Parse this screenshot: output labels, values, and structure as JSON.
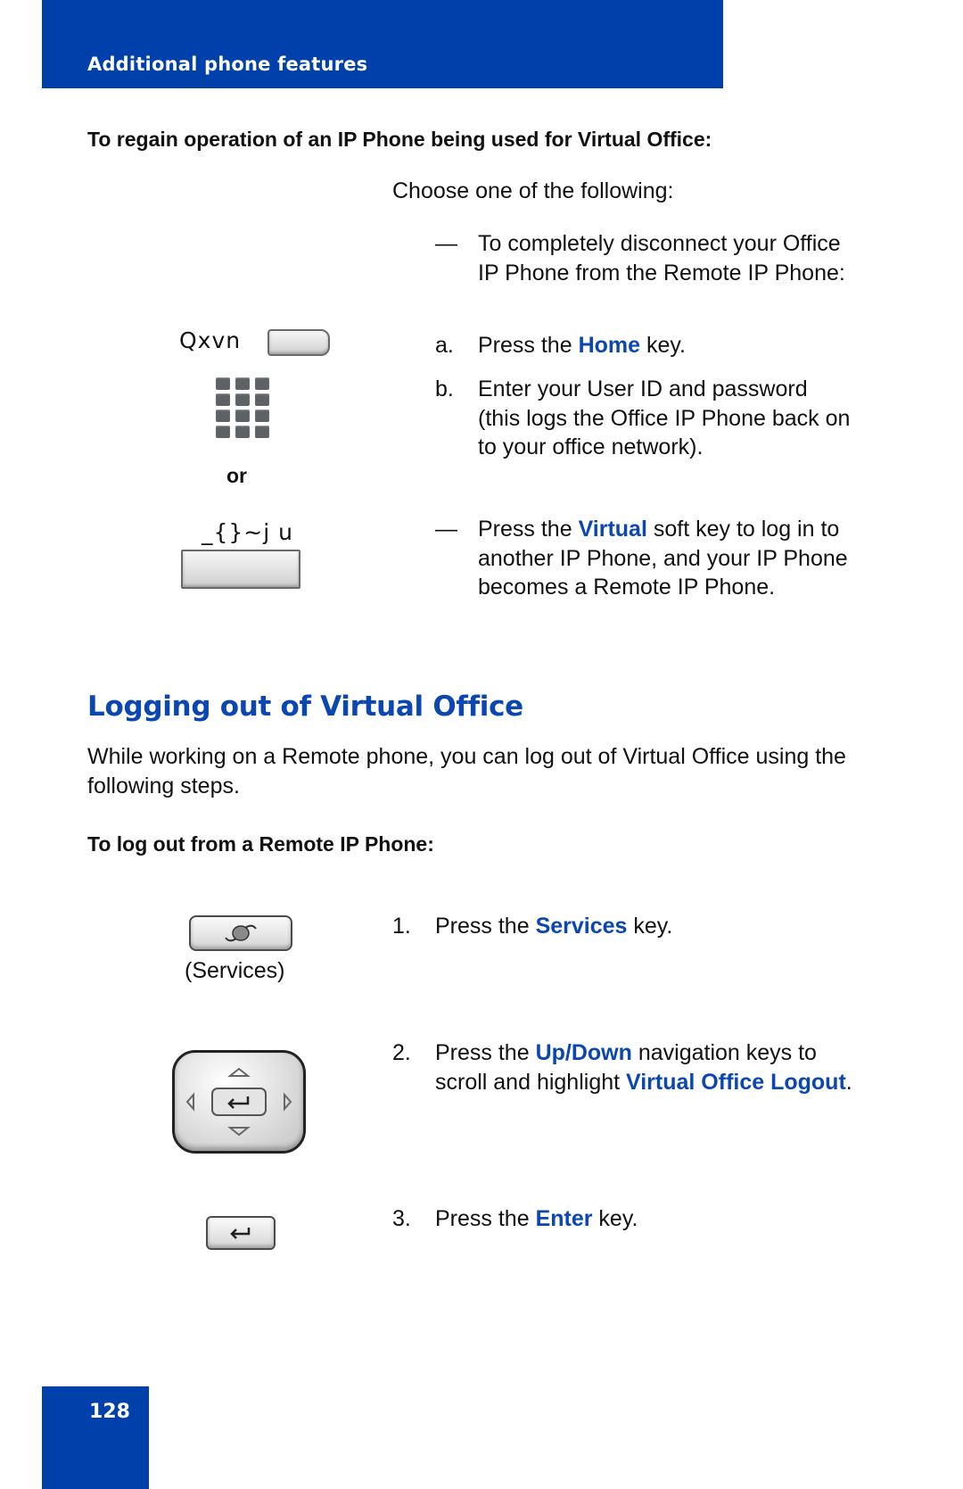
{
  "header": {
    "section_title": "Additional phone features"
  },
  "regain": {
    "title": "To regain operation of an IP Phone being used for Virtual Office:",
    "intro": "Choose one of the following:",
    "option1": {
      "marker": "—",
      "text": "To completely disconnect your Office IP Phone from the Remote IP Phone:",
      "steps": [
        {
          "marker": "a.",
          "pre": "Press the ",
          "key": "Home",
          "post": " key."
        },
        {
          "marker": "b.",
          "text": "Enter your User ID and password (this logs the Office IP Phone back on to your office network)."
        }
      ]
    },
    "option2": {
      "marker": "—",
      "pre": "Press the ",
      "key": "Virtual",
      "post": " soft key to log in to another IP Phone, and your IP Phone becomes a Remote IP Phone."
    },
    "left_icons": {
      "home_label": "Qxvn",
      "or_label": "or",
      "virtual_label": "_{}~j u",
      "icons": [
        "home-key-icon",
        "dialpad-icon",
        "virtual-softkey-icon"
      ]
    }
  },
  "logout": {
    "heading": "Logging out of Virtual Office",
    "intro": "While working on a Remote phone, you can log out of Virtual Office using the following steps.",
    "proc_title": "To log out from a Remote IP Phone:",
    "steps": [
      {
        "number": "1.",
        "pre": "Press the ",
        "key": "Services",
        "post": " key."
      },
      {
        "number": "2.",
        "pre": "Press the ",
        "key": "Up/Down",
        "mid": " navigation keys to scroll and highlight ",
        "key2": "Virtual Office Logout",
        "post": "."
      },
      {
        "number": "3.",
        "pre": "Press the ",
        "key": "Enter",
        "post": " key."
      }
    ],
    "services_caption": "(Services)",
    "icons": [
      "services-key-icon",
      "navigation-cluster-icon",
      "enter-key-icon"
    ]
  },
  "footer": {
    "page_number": "128"
  },
  "colors": {
    "brand_blue": "#0040ab",
    "keyword_blue": "#0b47b0"
  }
}
